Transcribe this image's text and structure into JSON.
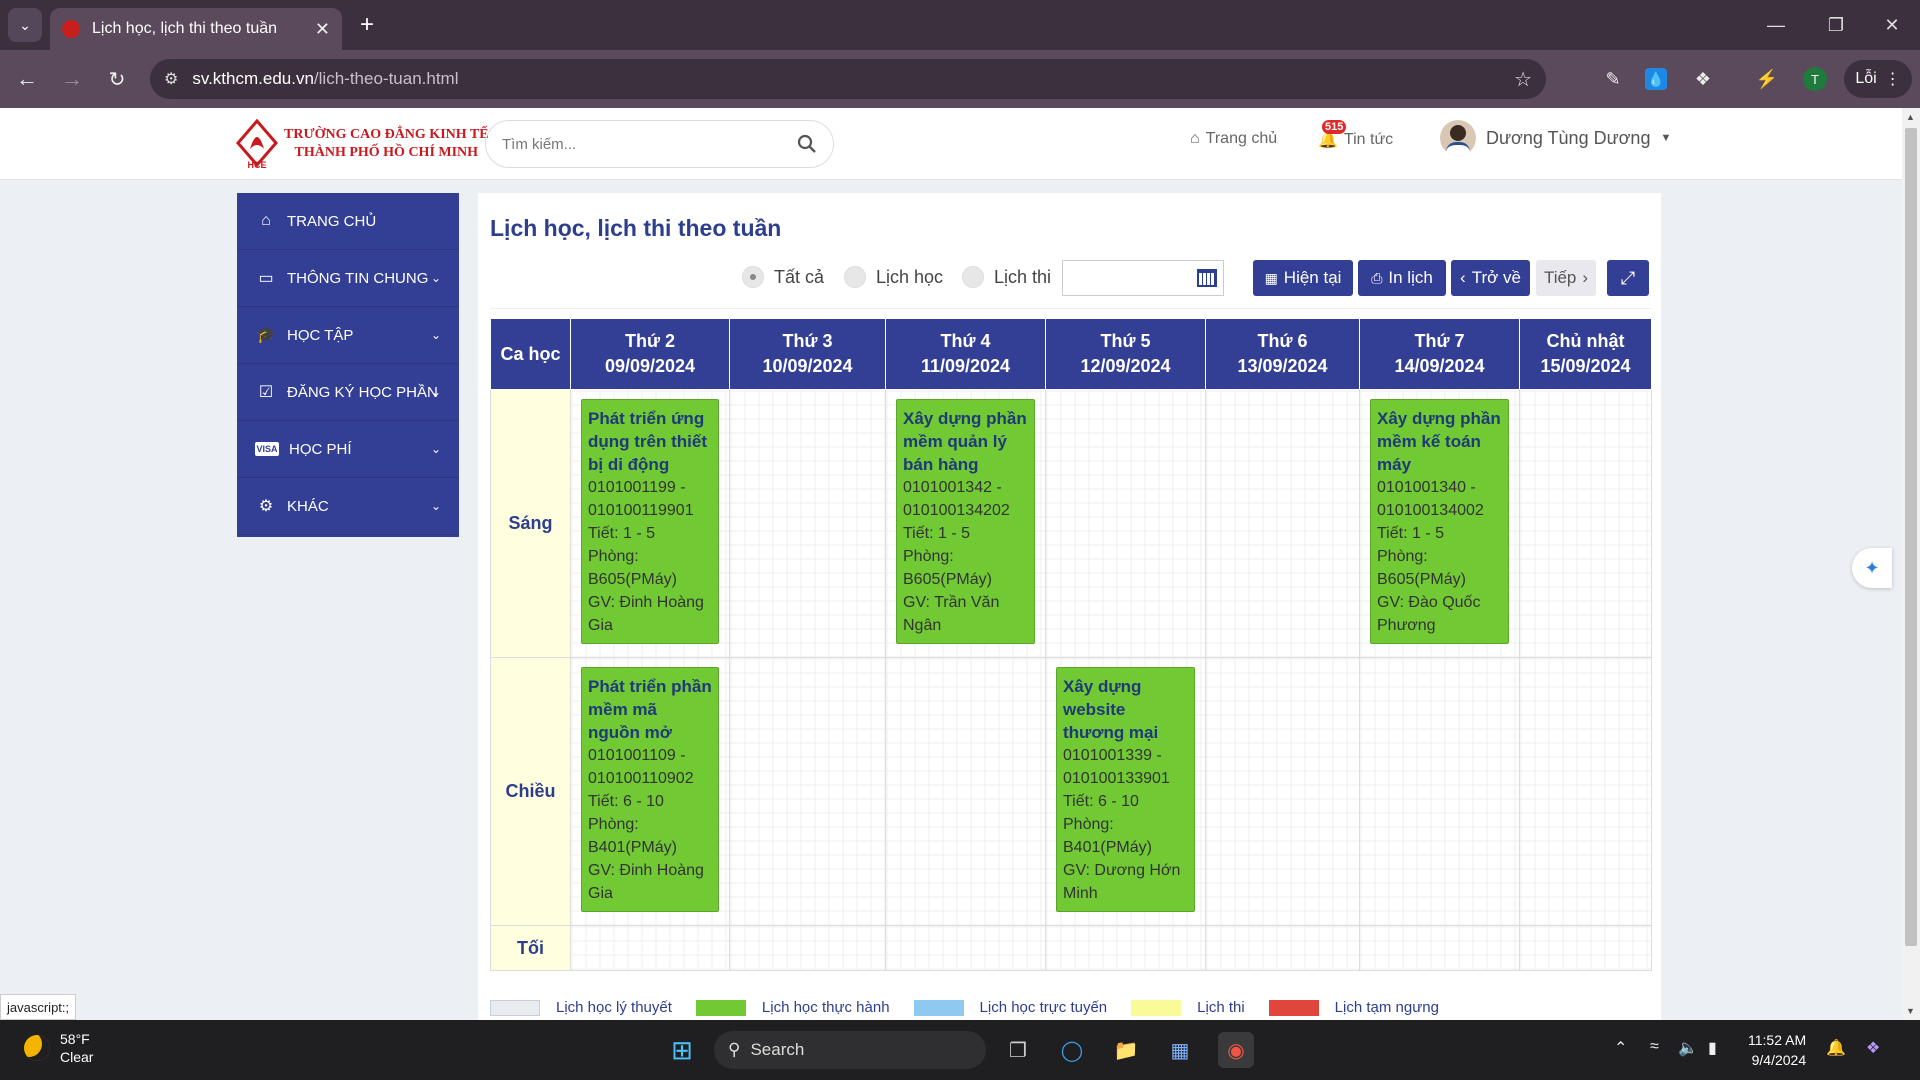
{
  "browser": {
    "tab_title": "Lịch học, lịch thi theo tuần",
    "url_host": "sv.kthcm.edu.vn",
    "url_path": "/lich-theo-tuan.html",
    "profile_initial": "T",
    "error_chip": "Lỗi"
  },
  "header": {
    "logo_line1": "TRƯỜNG CAO ĐẲNG KINH TẾ",
    "logo_line2": "THÀNH PHỐ HỒ CHÍ MINH",
    "logo_abbr": "HCE",
    "search_placeholder": "Tìm kiếm...",
    "home_label": "Trang chủ",
    "news_label": "Tin tức",
    "news_badge": "515",
    "user_name": "Dương Tùng Dương"
  },
  "sidebar": {
    "items": [
      {
        "label": "TRANG CHỦ",
        "icon": "home-icon"
      },
      {
        "label": "THÔNG TIN CHUNG",
        "icon": "monitor-icon"
      },
      {
        "label": "HỌC TẬP",
        "icon": "graduation-cap-icon"
      },
      {
        "label": "ĐĂNG KÝ HỌC PHẦN",
        "icon": "checkbox-icon"
      },
      {
        "label": "HỌC PHÍ",
        "icon": "visa-card-icon"
      },
      {
        "label": "KHÁC",
        "icon": "gear-icon"
      }
    ]
  },
  "main": {
    "title": "Lịch học, lịch thi theo tuần",
    "filters": {
      "all": "Tất cả",
      "study": "Lịch học",
      "exam": "Lịch thi",
      "selected": "all",
      "date_value": ""
    },
    "buttons": {
      "current": "Hiện tại",
      "print": "In lịch",
      "back": "Trở về",
      "next": "Tiếp"
    },
    "table": {
      "shift_header": "Ca học",
      "days": [
        {
          "name": "Thứ 2",
          "date": "09/09/2024"
        },
        {
          "name": "Thứ 3",
          "date": "10/09/2024"
        },
        {
          "name": "Thứ 4",
          "date": "11/09/2024"
        },
        {
          "name": "Thứ 5",
          "date": "12/09/2024"
        },
        {
          "name": "Thứ 6",
          "date": "13/09/2024"
        },
        {
          "name": "Thứ 7",
          "date": "14/09/2024"
        },
        {
          "name": "Chủ nhật",
          "date": "15/09/2024"
        }
      ],
      "shifts": [
        "Sáng",
        "Chiều",
        "Tối"
      ],
      "classes": {
        "sang_t2": {
          "subject": "Phát triển ứng dụng trên thiết bị di động",
          "code": "0101001199 - 010100119901",
          "periods": "Tiết: 1 - 5",
          "room_label": "Phòng:",
          "room": "B605(PMáy)",
          "teacher": "GV: Đinh Hoàng Gia"
        },
        "sang_t4": {
          "subject": "Xây dựng phần mềm quản lý bán hàng",
          "code": "0101001342 - 010100134202",
          "periods": "Tiết: 1 - 5",
          "room_label": "Phòng:",
          "room": "B605(PMáy)",
          "teacher": "GV: Trần Văn Ngân"
        },
        "sang_t7": {
          "subject": "Xây dựng phần mềm kế toán máy",
          "code": "0101001340 - 010100134002",
          "periods": "Tiết: 1 - 5",
          "room_label": "Phòng:",
          "room": "B605(PMáy)",
          "teacher": "GV: Đào Quốc Phương"
        },
        "chieu_t2": {
          "subject": "Phát triển phần mềm mã nguồn mở",
          "code": "0101001109 - 010100110902",
          "periods": "Tiết: 6 - 10",
          "room_label": "Phòng:",
          "room": "B401(PMáy)",
          "teacher": "GV: Đinh Hoàng Gia"
        },
        "chieu_t5": {
          "subject": "Xây dựng website thương mại",
          "code": "0101001339 - 010100133901",
          "periods": "Tiết: 6 - 10",
          "room_label": "Phòng:",
          "room": "B401(PMáy)",
          "teacher": "GV: Dương Hớn Minh"
        }
      }
    },
    "legend": [
      {
        "label": "Lịch học lý thuyết",
        "color": "#e8ecf0"
      },
      {
        "label": "Lịch học thực hành",
        "color": "#71c934"
      },
      {
        "label": "Lịch học trực tuyến",
        "color": "#8ec9f0"
      },
      {
        "label": "Lịch thi",
        "color": "#fafa96"
      },
      {
        "label": "Lịch tạm ngưng",
        "color": "#e0463c"
      }
    ]
  },
  "status_bar_text": "javascript:;",
  "taskbar": {
    "weather_temp": "58°F",
    "weather_desc": "Clear",
    "search_label": "Search",
    "time": "11:52 AM",
    "date": "9/4/2024"
  }
}
